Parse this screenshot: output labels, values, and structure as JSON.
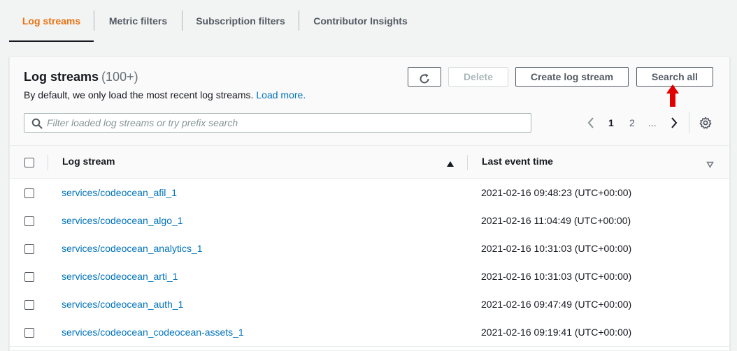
{
  "tabs": [
    {
      "label": "Log streams",
      "active": true
    },
    {
      "label": "Metric filters",
      "active": false
    },
    {
      "label": "Subscription filters",
      "active": false
    },
    {
      "label": "Contributor Insights",
      "active": false
    }
  ],
  "panel": {
    "title": "Log streams",
    "count": "(100+)",
    "description": "By default, we only load the most recent log streams.",
    "load_more_link": "Load more."
  },
  "toolbar": {
    "refresh_icon": "refresh-icon",
    "delete_label": "Delete",
    "create_label": "Create log stream",
    "search_all_label": "Search all"
  },
  "search": {
    "placeholder": "Filter loaded log streams or try prefix search",
    "value": ""
  },
  "pagination": {
    "page_1": "1",
    "page_2": "2",
    "ellipsis": "...",
    "current": 1
  },
  "table": {
    "columns": {
      "log_stream": "Log stream",
      "last_event_time": "Last event time"
    },
    "rows": [
      {
        "name": "services/codeocean_afil_1",
        "time": "2021-02-16 09:48:23 (UTC+00:00)"
      },
      {
        "name": "services/codeocean_algo_1",
        "time": "2021-02-16 11:04:49 (UTC+00:00)"
      },
      {
        "name": "services/codeocean_analytics_1",
        "time": "2021-02-16 10:31:03 (UTC+00:00)"
      },
      {
        "name": "services/codeocean_arti_1",
        "time": "2021-02-16 10:31:03 (UTC+00:00)"
      },
      {
        "name": "services/codeocean_auth_1",
        "time": "2021-02-16 09:47:49 (UTC+00:00)"
      },
      {
        "name": "services/codeocean_codeocean-assets_1",
        "time": "2021-02-16 09:19:41 (UTC+00:00)"
      }
    ]
  },
  "colors": {
    "accent": "#ec7211",
    "link": "#0073bb",
    "annotation": "#e00000"
  }
}
